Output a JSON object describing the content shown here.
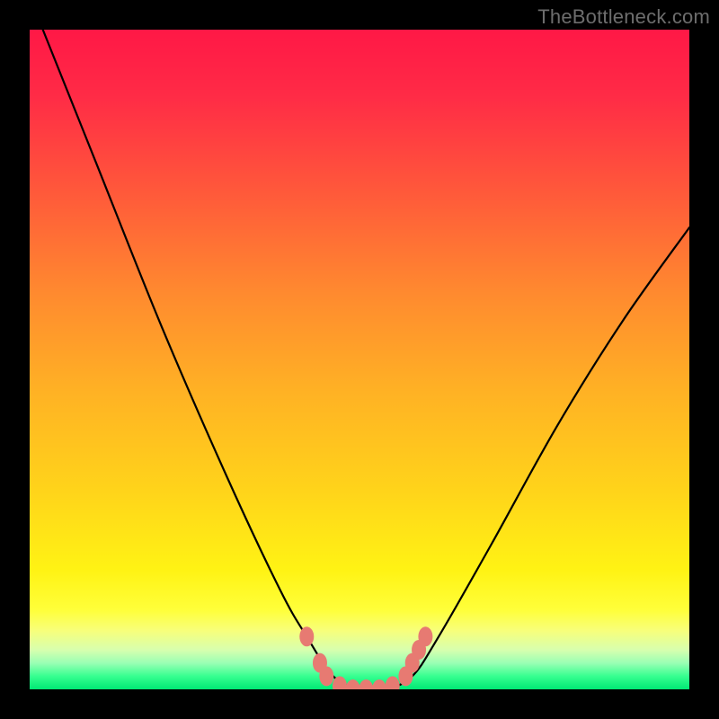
{
  "watermark": {
    "text": "TheBottleneck.com"
  },
  "chart_data": {
    "type": "line",
    "title": "",
    "xlabel": "",
    "ylabel": "",
    "ylim": [
      0,
      100
    ],
    "xlim": [
      0,
      100
    ],
    "series": [
      {
        "name": "bottleneck-curve",
        "x": [
          2,
          10,
          20,
          30,
          38,
          42,
          46,
          50,
          54,
          58,
          62,
          70,
          80,
          90,
          100
        ],
        "values": [
          100,
          80,
          55,
          32,
          15,
          8,
          2,
          0,
          0,
          2,
          8,
          22,
          40,
          56,
          70
        ]
      }
    ],
    "markers": {
      "name": "highlight-dots",
      "color": "#e77a72",
      "points": [
        {
          "x": 42,
          "y": 8
        },
        {
          "x": 44,
          "y": 4
        },
        {
          "x": 45,
          "y": 2
        },
        {
          "x": 47,
          "y": 0.5
        },
        {
          "x": 49,
          "y": 0
        },
        {
          "x": 51,
          "y": 0
        },
        {
          "x": 53,
          "y": 0
        },
        {
          "x": 55,
          "y": 0.5
        },
        {
          "x": 57,
          "y": 2
        },
        {
          "x": 58,
          "y": 4
        },
        {
          "x": 59,
          "y": 6
        },
        {
          "x": 60,
          "y": 8
        }
      ]
    },
    "background": "rainbow-gradient (red top → green bottom)"
  }
}
